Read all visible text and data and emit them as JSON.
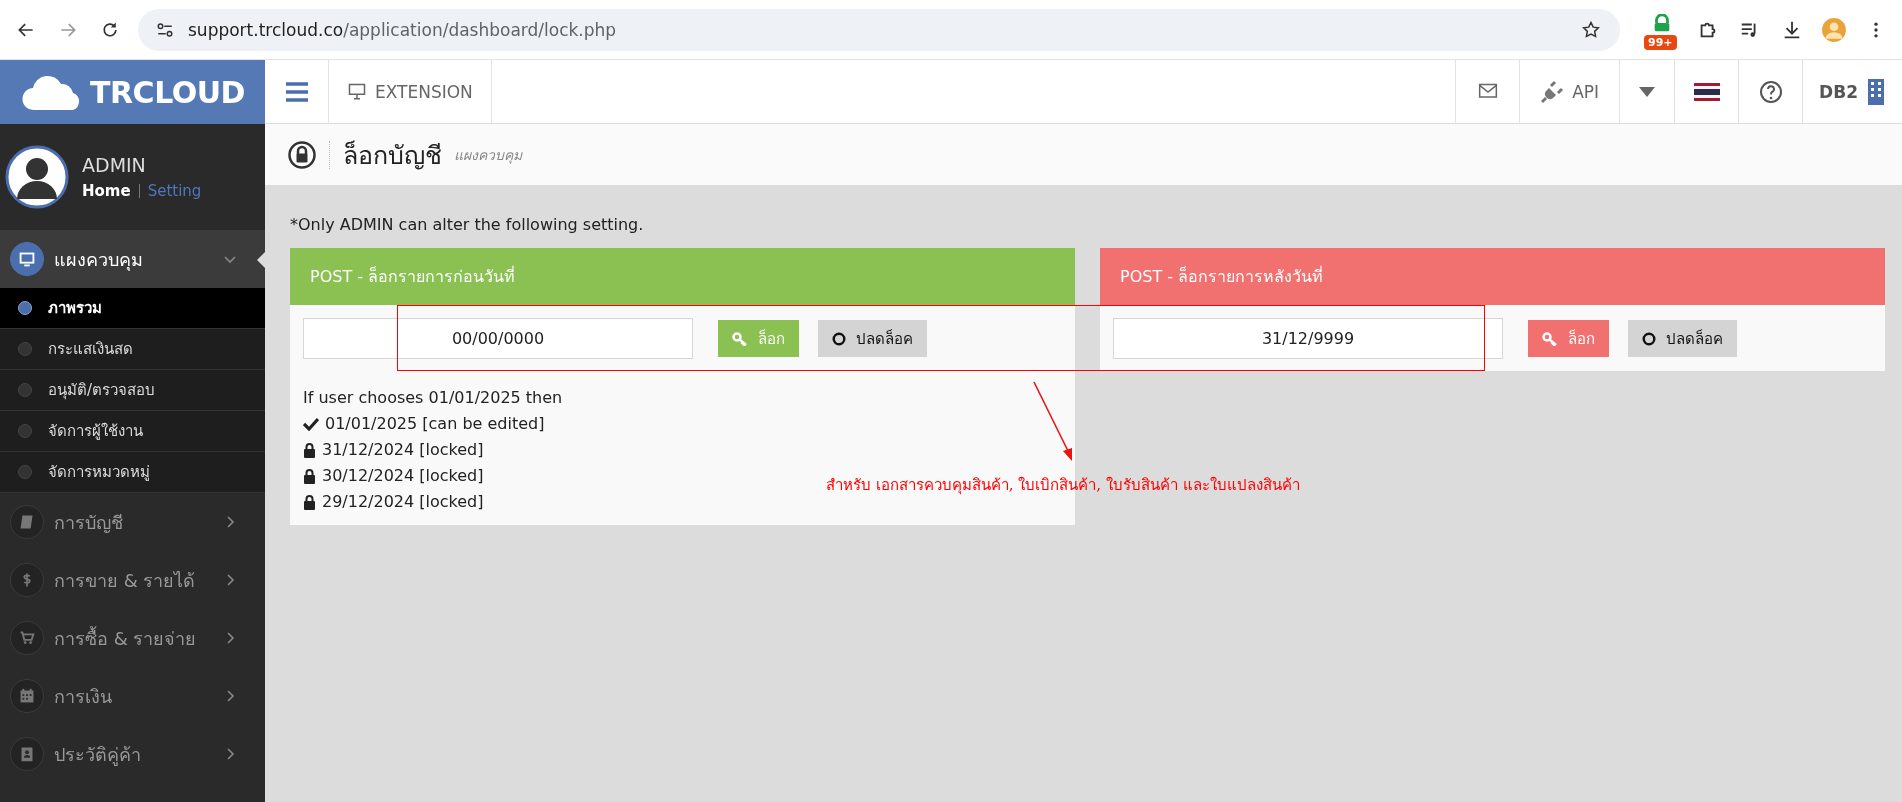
{
  "browser": {
    "url_host": "support.trcloud.co",
    "url_path": "/application/dashboard/lock.php",
    "extension_badge": "99+"
  },
  "header": {
    "logo": "TRCLOUD",
    "menu_items": [
      {
        "label": "EXTENSION"
      }
    ],
    "api_label": "API",
    "db_label": "DB2"
  },
  "sidebar": {
    "user": {
      "name": "ADMIN",
      "links": [
        {
          "label": "Home",
          "selected": true
        },
        {
          "label": "Setting",
          "selected": false
        }
      ]
    },
    "items": [
      {
        "label": "แผงควบคุม",
        "selected": true,
        "expanded": true,
        "children": [
          {
            "label": "ภาพรวม",
            "selected": true
          },
          {
            "label": "กระแสเงินสด",
            "selected": false
          },
          {
            "label": "อนุมัติ/ตรวจสอบ",
            "selected": false
          },
          {
            "label": "จัดการผู้ใช้งาน",
            "selected": false
          },
          {
            "label": "จัดการหมวดหมู่",
            "selected": false
          }
        ]
      },
      {
        "label": "การบัญชี",
        "selected": false,
        "expanded": false
      },
      {
        "label": "การขาย & รายได้",
        "selected": false,
        "expanded": false
      },
      {
        "label": "การซื้อ & รายจ่าย",
        "selected": false,
        "expanded": false
      },
      {
        "label": "การเงิน",
        "selected": false,
        "expanded": false
      },
      {
        "label": "ประวัติคู่ค้า",
        "selected": false,
        "expanded": false
      }
    ]
  },
  "page": {
    "title": "ล็อกบัญชี",
    "subtitle": "แผงควบคุม",
    "note": "*Only ADMIN can alter the following setting.",
    "panels": [
      {
        "title": "POST - ล็อกรายการก่อนวันที่",
        "color": "#8bc152",
        "date": "00/00/0000",
        "lock_label": "ล็อก",
        "unlock_label": "ปลดล็อค",
        "info": [
          {
            "kind": "text",
            "text": "If user chooses 01/01/2025 then"
          },
          {
            "kind": "check",
            "text": "01/01/2025 [can be edited]"
          },
          {
            "kind": "lock",
            "text": "31/12/2024 [locked]"
          },
          {
            "kind": "lock",
            "text": "30/12/2024 [locked]"
          },
          {
            "kind": "lock",
            "text": "29/12/2024 [locked]"
          }
        ]
      },
      {
        "title": "POST - ล็อกรายการหลังวันที่",
        "color": "#f07170",
        "date": "31/12/9999",
        "lock_label": "ล็อก",
        "unlock_label": "ปลดล็อค"
      }
    ]
  },
  "annotation": {
    "text": "สำหรับ เอกสารควบคุมสินค้า, ใบเบิกสินค้า, ใบรับสินค้า และใบแปลงสินค้า"
  }
}
